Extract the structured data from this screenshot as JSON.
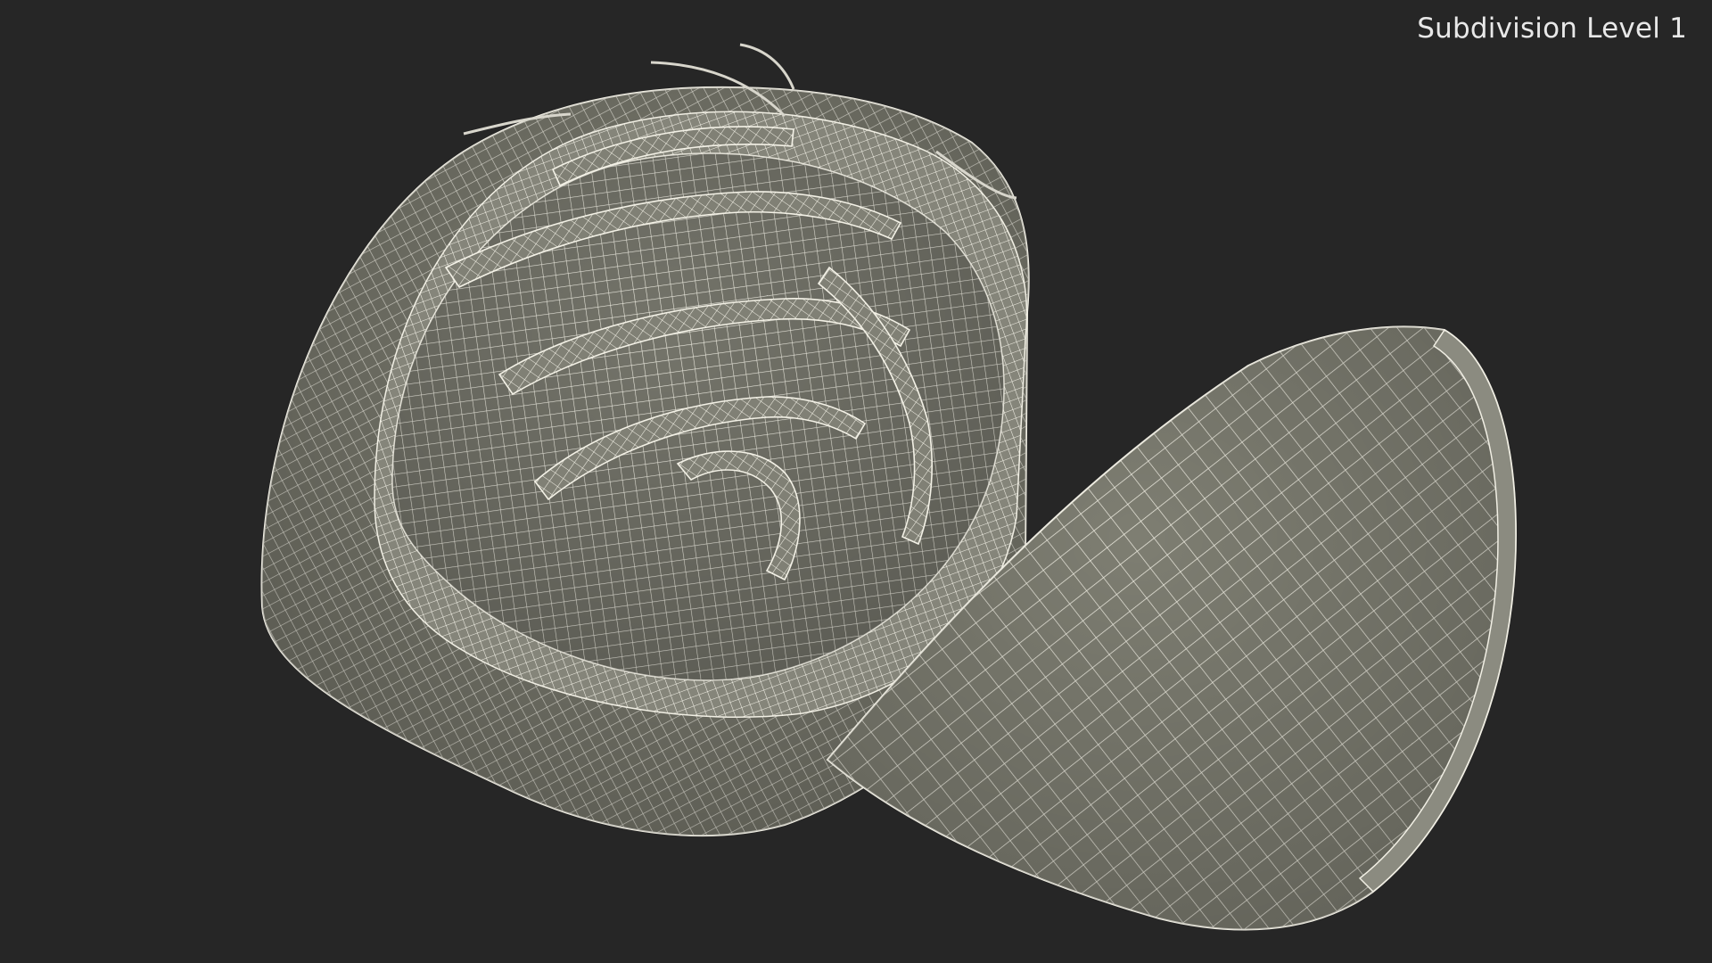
{
  "viewport": {
    "subdivision_label": "Subdivision Level 1",
    "background_color": "#262626",
    "surface_color": "#7c7c70",
    "wire_color": "#f2f0e6"
  },
  "scene": {
    "objects": [
      "nut-shell-with-kernel",
      "empty-half-shell"
    ]
  }
}
